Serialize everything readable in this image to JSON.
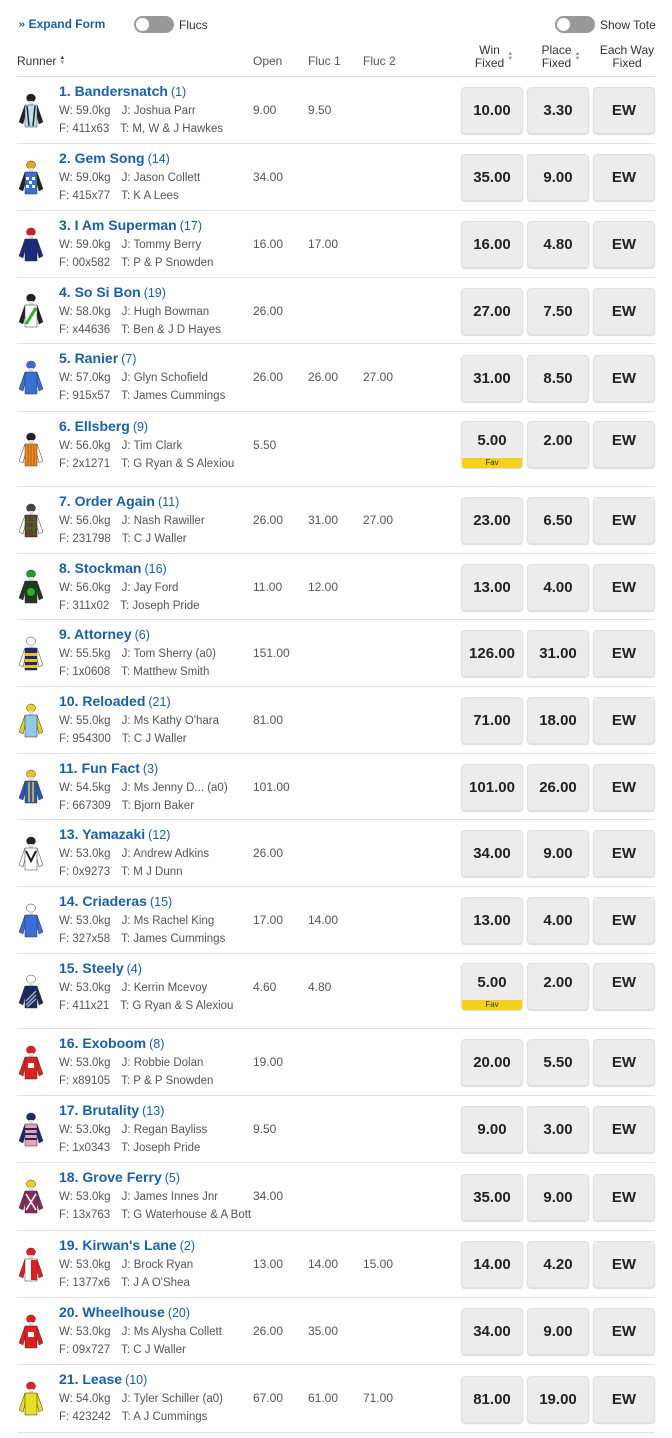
{
  "toolbar": {
    "expand_label": "Expand Form",
    "flucs_label": "Flucs",
    "show_tote_label": "Show Tote",
    "flucs_on": false,
    "show_tote_on": false
  },
  "columns": {
    "runner": "Runner",
    "open": "Open",
    "fluc1": "Fluc 1",
    "fluc2": "Fluc 2",
    "win_line1": "Win",
    "win_line2": "Fixed",
    "place_line1": "Place",
    "place_line2": "Fixed",
    "ew_line1": "Each Way",
    "ew_line2": "Fixed"
  },
  "ew_label": "EW",
  "fav_label": "Fav",
  "runners": [
    {
      "name": "1. Bandersnatch",
      "barrier": "(1)",
      "weight": "W: 59.0kg",
      "jockey": "J: Joshua Parr",
      "form": "F: 411x63",
      "trainer": "T: M, W & J Hawkes",
      "open": "9.00",
      "fluc1": "9.50",
      "fluc2": "",
      "win": "10.00",
      "place": "3.30",
      "fav": false,
      "silk": {
        "body": "#bfe0ef",
        "sleeve": "#222222",
        "cap": "#222222",
        "pattern": "braces"
      }
    },
    {
      "name": "2. Gem Song",
      "barrier": "(14)",
      "weight": "W: 59.0kg",
      "jockey": "J: Jason Collett",
      "form": "F: 415x77",
      "trainer": "T: K A Lees",
      "open": "34.00",
      "fluc1": "",
      "fluc2": "",
      "win": "35.00",
      "place": "9.00",
      "fav": false,
      "silk": {
        "body": "#3a6fd0",
        "sleeve": "#222222",
        "cap": "#f0a020",
        "pattern": "checks"
      }
    },
    {
      "name": "3. I Am Superman",
      "barrier": "(17)",
      "weight": "W: 59.0kg",
      "jockey": "J: Tommy Berry",
      "form": "F: 00x582",
      "trainer": "T: P & P Snowden",
      "open": "16.00",
      "fluc1": "17.00",
      "fluc2": "",
      "win": "16.00",
      "place": "4.80",
      "fav": false,
      "silk": {
        "body": "#1b2a7a",
        "sleeve": "#1b2a7a",
        "cap": "#d02020",
        "pattern": "plain"
      }
    },
    {
      "name": "4. So Si Bon",
      "barrier": "(19)",
      "weight": "W: 58.0kg",
      "jockey": "J: Hugh Bowman",
      "form": "F: x44636",
      "trainer": "T: Ben & J D Hayes",
      "open": "26.00",
      "fluc1": "",
      "fluc2": "",
      "win": "27.00",
      "place": "7.50",
      "fav": false,
      "silk": {
        "body": "#ffffff",
        "sleeve": "#222222",
        "cap": "#222222",
        "pattern": "sash-green"
      }
    },
    {
      "name": "5. Ranier",
      "barrier": "(7)",
      "weight": "W: 57.0kg",
      "jockey": "J: Glyn Schofield",
      "form": "F: 915x57",
      "trainer": "T: James Cummings",
      "open": "26.00",
      "fluc1": "26.00",
      "fluc2": "27.00",
      "win": "31.00",
      "place": "8.50",
      "fav": false,
      "silk": {
        "body": "#3a6fd8",
        "sleeve": "#3a6fd8",
        "cap": "#3a6fd8",
        "pattern": "plain"
      }
    },
    {
      "name": "6. Ellsberg",
      "barrier": "(9)",
      "weight": "W: 56.0kg",
      "jockey": "J: Tim Clark",
      "form": "F: 2x1271",
      "trainer": "T: G Ryan & S Alexiou",
      "open": "5.50",
      "fluc1": "",
      "fluc2": "",
      "win": "5.00",
      "place": "2.00",
      "fav": true,
      "silk": {
        "body": "#f08a20",
        "sleeve": "#ffffff",
        "cap": "#222222",
        "pattern": "stripes"
      }
    },
    {
      "name": "7. Order Again",
      "barrier": "(11)",
      "weight": "W: 56.0kg",
      "jockey": "J: Nash Rawiller",
      "form": "F: 231798",
      "trainer": "T: C J Waller",
      "open": "26.00",
      "fluc1": "31.00",
      "fluc2": "27.00",
      "win": "23.00",
      "place": "6.50",
      "fav": false,
      "silk": {
        "body": "#6a3a2a",
        "sleeve": "#ffffff",
        "cap": "#444444",
        "pattern": "tartan"
      }
    },
    {
      "name": "8. Stockman",
      "barrier": "(16)",
      "weight": "W: 56.0kg",
      "jockey": "J: Jay Ford",
      "form": "F: 311x02",
      "trainer": "T: Joseph Pride",
      "open": "11.00",
      "fluc1": "12.00",
      "fluc2": "",
      "win": "13.00",
      "place": "4.00",
      "fav": false,
      "silk": {
        "body": "#1f3a1f",
        "sleeve": "#1f3a1f",
        "cap": "#2a9a2a",
        "pattern": "spot"
      }
    },
    {
      "name": "9. Attorney",
      "barrier": "(6)",
      "weight": "W: 55.5kg",
      "jockey": "J: Tom Sherry (a0)",
      "form": "F: 1x0608",
      "trainer": "T: Matthew Smith",
      "open": "151.00",
      "fluc1": "",
      "fluc2": "",
      "win": "126.00",
      "place": "31.00",
      "fav": false,
      "silk": {
        "body": "#1a2a6a",
        "sleeve": "#ffffff",
        "cap": "#ffffff",
        "pattern": "hoops-yellow"
      }
    },
    {
      "name": "10. Reloaded",
      "barrier": "(21)",
      "weight": "W: 55.0kg",
      "jockey": "J: Ms Kathy O'hara",
      "form": "F: 954300",
      "trainer": "T: C J Waller",
      "open": "81.00",
      "fluc1": "",
      "fluc2": "",
      "win": "71.00",
      "place": "18.00",
      "fav": false,
      "silk": {
        "body": "#8fc8e8",
        "sleeve": "#e8d020",
        "cap": "#e8d020",
        "pattern": "plain"
      }
    },
    {
      "name": "11. Fun Fact",
      "barrier": "(3)",
      "weight": "W: 54.5kg",
      "jockey": "J: Ms Jenny D... (a0)",
      "form": "F: 667309",
      "trainer": "T: Bjorn Baker",
      "open": "101.00",
      "fluc1": "",
      "fluc2": "",
      "win": "101.00",
      "place": "26.00",
      "fav": false,
      "silk": {
        "body": "#2a5ab8",
        "sleeve": "#2a5ab8",
        "cap": "#f0c020",
        "pattern": "stripes-yellow"
      }
    },
    {
      "name": "13. Yamazaki",
      "barrier": "(12)",
      "weight": "W: 53.0kg",
      "jockey": "J: Andrew Adkins",
      "form": "F: 0x9273",
      "trainer": "T: M J Dunn",
      "open": "26.00",
      "fluc1": "",
      "fluc2": "",
      "win": "34.00",
      "place": "9.00",
      "fav": false,
      "silk": {
        "body": "#ffffff",
        "sleeve": "#ffffff",
        "cap": "#222222",
        "pattern": "chevron"
      }
    },
    {
      "name": "14. Criaderas",
      "barrier": "(15)",
      "weight": "W: 53.0kg",
      "jockey": "J: Ms Rachel King",
      "form": "F: 327x58",
      "trainer": "T: James Cummings",
      "open": "17.00",
      "fluc1": "14.00",
      "fluc2": "",
      "win": "13.00",
      "place": "4.00",
      "fav": false,
      "silk": {
        "body": "#3a6fd8",
        "sleeve": "#3a6fd8",
        "cap": "#ffffff",
        "pattern": "plain"
      }
    },
    {
      "name": "15. Steely",
      "barrier": "(4)",
      "weight": "W: 53.0kg",
      "jockey": "J: Kerrin Mcevoy",
      "form": "F: 411x21",
      "trainer": "T: G Ryan & S Alexiou",
      "open": "4.60",
      "fluc1": "4.80",
      "fluc2": "",
      "win": "5.00",
      "place": "2.00",
      "fav": true,
      "silk": {
        "body": "#1a2a5a",
        "sleeve": "#1a2a5a",
        "cap": "#ffffff",
        "pattern": "diag"
      }
    },
    {
      "name": "16. Exoboom",
      "barrier": "(8)",
      "weight": "W: 53.0kg",
      "jockey": "J: Robbie Dolan",
      "form": "F: x89105",
      "trainer": "T: P & P Snowden",
      "open": "19.00",
      "fluc1": "",
      "fluc2": "",
      "win": "20.00",
      "place": "5.50",
      "fav": false,
      "silk": {
        "body": "#e02020",
        "sleeve": "#e02020",
        "cap": "#e02020",
        "pattern": "logo"
      }
    },
    {
      "name": "17. Brutality",
      "barrier": "(13)",
      "weight": "W: 53.0kg",
      "jockey": "J: Regan Bayliss",
      "form": "F: 1x0343",
      "trainer": "T: Joseph Pride",
      "open": "9.50",
      "fluc1": "",
      "fluc2": "",
      "win": "9.00",
      "place": "3.00",
      "fav": false,
      "silk": {
        "body": "#e8a0b0",
        "sleeve": "#1a2a6a",
        "cap": "#1a2a6a",
        "pattern": "hoops-navy"
      }
    },
    {
      "name": "18. Grove Ferry",
      "barrier": "(5)",
      "weight": "W: 53.0kg",
      "jockey": "J: James Innes Jnr",
      "form": "F: 13x763",
      "trainer": "T: G Waterhouse & A Bott",
      "open": "34.00",
      "fluc1": "",
      "fluc2": "",
      "win": "35.00",
      "place": "9.00",
      "fav": false,
      "silk": {
        "body": "#8a2a5a",
        "sleeve": "#8a2a5a",
        "cap": "#e8d020",
        "pattern": "cross"
      }
    },
    {
      "name": "19. Kirwan's Lane",
      "barrier": "(2)",
      "weight": "W: 53.0kg",
      "jockey": "J: Brock Ryan",
      "form": "F: 1377x6",
      "trainer": "T: J A O'Shea",
      "open": "13.00",
      "fluc1": "14.00",
      "fluc2": "15.00",
      "win": "14.00",
      "place": "4.20",
      "fav": false,
      "silk": {
        "body": "#ffffff",
        "sleeve": "#e02020",
        "cap": "#e02020",
        "pattern": "halves"
      }
    },
    {
      "name": "20. Wheelhouse",
      "barrier": "(20)",
      "weight": "W: 53.0kg",
      "jockey": "J: Ms Alysha Collett",
      "form": "F: 09x727",
      "trainer": "T: C J Waller",
      "open": "26.00",
      "fluc1": "35.00",
      "fluc2": "",
      "win": "34.00",
      "place": "9.00",
      "fav": false,
      "silk": {
        "body": "#e02020",
        "sleeve": "#e02020",
        "cap": "#e02020",
        "pattern": "logo"
      }
    },
    {
      "name": "21. Lease",
      "barrier": "(10)",
      "weight": "W: 54.0kg",
      "jockey": "J: Tyler Schiller (a0)",
      "form": "F: 423242",
      "trainer": "T: A J Cummings",
      "open": "67.00",
      "fluc1": "61.00",
      "fluc2": "71.00",
      "win": "81.00",
      "place": "19.00",
      "fav": false,
      "silk": {
        "body": "#e8e020",
        "sleeve": "#e8e020",
        "cap": "#e02020",
        "pattern": "plain"
      }
    }
  ]
}
